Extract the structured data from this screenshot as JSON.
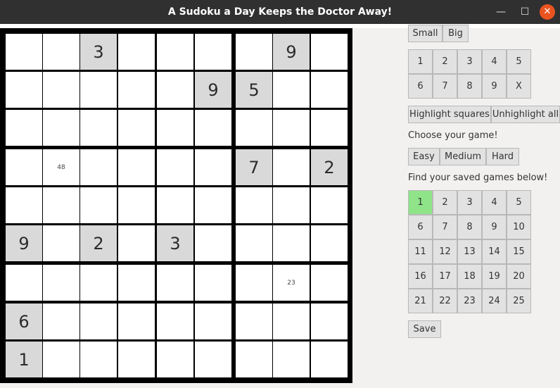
{
  "window": {
    "title": "A Sudoku a Day Keeps the Doctor Away!",
    "minimize_glyph": "—",
    "maximize_glyph": "☐",
    "close_glyph": "✕"
  },
  "board": {
    "cells": [
      [
        "",
        "",
        "3",
        "",
        "",
        "",
        "",
        "9",
        ""
      ],
      [
        "",
        "",
        "",
        "",
        "",
        "9",
        "5",
        "",
        ""
      ],
      [
        "",
        "",
        "",
        "",
        "",
        "",
        "",
        "",
        ""
      ],
      [
        "",
        "48",
        "",
        "",
        "",
        "",
        "7",
        "",
        "2"
      ],
      [
        "",
        "",
        "",
        "",
        "",
        "",
        "",
        "",
        ""
      ],
      [
        "9",
        "",
        "2",
        "",
        "3",
        "",
        "",
        "",
        ""
      ],
      [
        "",
        "",
        "",
        "",
        "",
        "",
        "",
        "23",
        ""
      ],
      [
        "6",
        "",
        "",
        "",
        "",
        "",
        "",
        "",
        ""
      ],
      [
        "1",
        "",
        "",
        "",
        "",
        "",
        "",
        "",
        ""
      ]
    ],
    "given": [
      [
        0,
        0,
        1,
        0,
        0,
        0,
        0,
        1,
        0
      ],
      [
        0,
        0,
        0,
        0,
        0,
        1,
        1,
        0,
        0
      ],
      [
        0,
        0,
        0,
        0,
        0,
        0,
        0,
        0,
        0
      ],
      [
        0,
        0,
        0,
        0,
        0,
        0,
        1,
        0,
        1
      ],
      [
        0,
        0,
        0,
        0,
        0,
        0,
        0,
        0,
        0
      ],
      [
        1,
        0,
        1,
        0,
        1,
        0,
        0,
        0,
        0
      ],
      [
        0,
        0,
        0,
        0,
        0,
        0,
        0,
        0,
        0
      ],
      [
        1,
        0,
        0,
        0,
        0,
        0,
        0,
        0,
        0
      ],
      [
        1,
        0,
        0,
        0,
        0,
        0,
        0,
        0,
        0
      ]
    ]
  },
  "size_buttons": [
    "Small",
    "Big"
  ],
  "number_pad": [
    "1",
    "2",
    "3",
    "4",
    "5",
    "6",
    "7",
    "8",
    "9",
    "X"
  ],
  "highlight": {
    "highlight_label": "Highlight squares",
    "unhighlight_label": "Unhighlight all"
  },
  "choose_game_label": "Choose your game!",
  "difficulty": [
    "Easy",
    "Medium",
    "Hard"
  ],
  "saved_label": "Find your saved games below!",
  "saved_games": [
    "1",
    "2",
    "3",
    "4",
    "5",
    "6",
    "7",
    "8",
    "9",
    "10",
    "11",
    "12",
    "13",
    "14",
    "15",
    "16",
    "17",
    "18",
    "19",
    "20",
    "21",
    "22",
    "23",
    "24",
    "25"
  ],
  "saved_selected": 1,
  "save_label": "Save",
  "colors": {
    "selected_game": "#8fe388",
    "given_cell": "#d9d9d9",
    "close_button": "#e95420"
  }
}
